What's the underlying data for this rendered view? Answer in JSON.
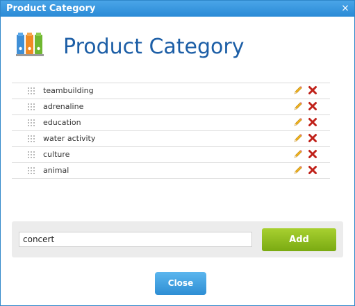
{
  "window": {
    "title": "Product Category",
    "close_glyph": "×"
  },
  "header": {
    "heading": "Product Category",
    "icon": "binders-icon"
  },
  "categories": [
    {
      "label": "teambuilding"
    },
    {
      "label": "adrenaline"
    },
    {
      "label": "education"
    },
    {
      "label": "water activity"
    },
    {
      "label": "culture"
    },
    {
      "label": "animal"
    }
  ],
  "add_form": {
    "input_value": "concert",
    "add_label": "Add"
  },
  "footer": {
    "close_label": "Close"
  },
  "colors": {
    "titlebar": "#2a8ad6",
    "heading": "#1c5ea6",
    "add_button": "#8dbb1e",
    "close_button": "#3a98d8",
    "delete_icon": "#c0221a"
  }
}
